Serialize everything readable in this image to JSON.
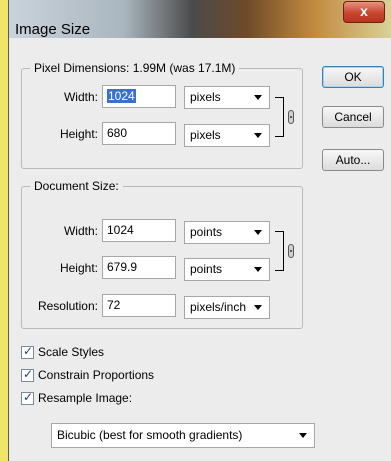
{
  "window": {
    "title": "Image Size",
    "close_glyph": "x"
  },
  "pixel_dimensions": {
    "legend": "Pixel Dimensions:  1.99M (was 17.1M)",
    "width_label": "Width:",
    "width_value": "1024",
    "width_unit": "pixels",
    "height_label": "Height:",
    "height_value": "680",
    "height_unit": "pixels"
  },
  "document_size": {
    "legend": "Document Size:",
    "width_label": "Width:",
    "width_value": "1024",
    "width_unit": "points",
    "height_label": "Height:",
    "height_value": "679.9",
    "height_unit": "points",
    "resolution_label": "Resolution:",
    "resolution_value": "72",
    "resolution_unit": "pixels/inch"
  },
  "buttons": {
    "ok": "OK",
    "cancel": "Cancel",
    "auto": "Auto..."
  },
  "options": {
    "scale_styles": "Scale Styles",
    "constrain_proportions": "Constrain Proportions",
    "resample_image": "Resample Image:",
    "resample_method": "Bicubic (best for smooth gradients)"
  }
}
